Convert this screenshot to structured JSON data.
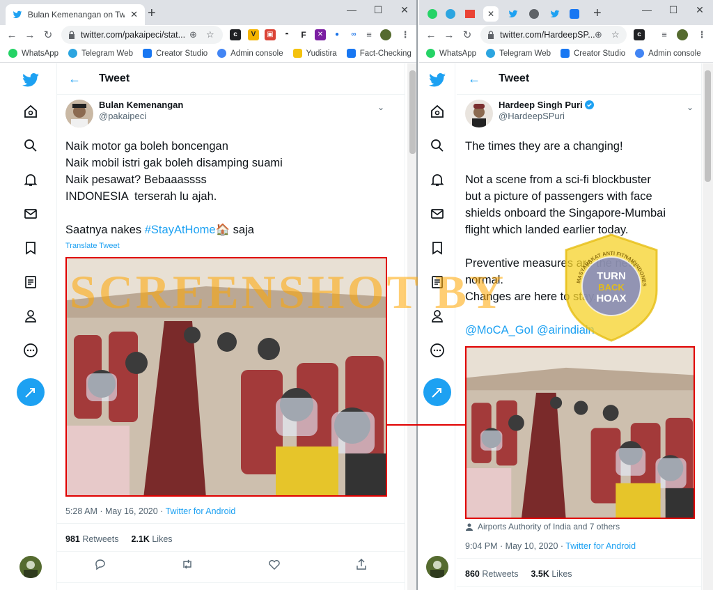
{
  "left": {
    "tab_title": "Bulan Kemenangan on Twitter: \"N",
    "url": "twitter.com/pakaipeci/stat...",
    "bookmarks": [
      "WhatsApp",
      "Telegram Web",
      "Creator Studio",
      "Admin console",
      "Yudistira",
      "Fact-Checking"
    ],
    "header": "Tweet",
    "author_name": "Bulan Kemenangan",
    "author_handle": "@pakaipeci",
    "tweet_lines": [
      "Naik motor ga boleh boncengan",
      "Naik mobil istri gak boleh disamping suami",
      "Naik pesawat? Bebaaassss",
      "INDONESIA  terserah lu ajah."
    ],
    "tweet_last_prefix": "Saatnya nakes ",
    "hashtag": "#StayAtHome",
    "tweet_last_suffix": " saja",
    "translate": "Translate Tweet",
    "time": "5:28 AM · May 16, 2020 · ",
    "source": "Twitter for Android",
    "retweets_count": "981",
    "retweets_label": "Retweets",
    "likes_count": "2.1K",
    "likes_label": "Likes"
  },
  "right": {
    "url": "twitter.com/HardeepSP...",
    "bookmarks": [
      "WhatsApp",
      "Telegram Web",
      "Creator Studio",
      "Admin console"
    ],
    "header": "Tweet",
    "author_name": "Hardeep Singh Puri",
    "author_handle": "@HardeepSPuri",
    "tweet_p1": "The times they are a changing!",
    "tweet_p2": [
      "Not a scene from a sci-fi blockbuster",
      "but a picture of passengers with face",
      "shields onboard the Singapore-Mumbai",
      "flight which landed earlier today."
    ],
    "tweet_p3": [
      "Preventive measures are the new",
      "normal.",
      "Changes are here to stay."
    ],
    "mentions": "@MoCA_GoI @airindiain",
    "attribution": "Airports Authority of India and 7 others",
    "time": "9:04 PM · May 10, 2020 · ",
    "source": "Twitter for Android",
    "retweets_count": "860",
    "retweets_label": "Retweets",
    "likes_count": "3.5K",
    "likes_label": "Likes"
  },
  "watermark": "SCREENSHOT BY",
  "badge": {
    "line1": "TURN",
    "line2": "BACK",
    "line3": "HOAX",
    "ring_text": "MASYARAKAT ANTI FITNAH INDONESIA · MAFINDO"
  },
  "colors": {
    "twitter_blue": "#1da1f2",
    "highlight_red": "#e00000"
  }
}
